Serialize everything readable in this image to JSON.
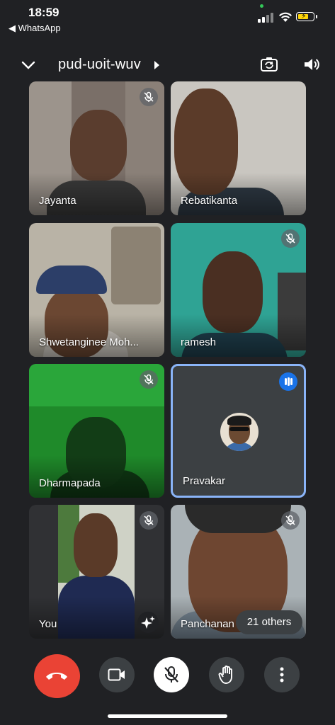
{
  "status_bar": {
    "time": "18:59",
    "back_label": "◀ WhatsApp",
    "battery_color": "#ffd60a"
  },
  "header": {
    "meeting_code": "pud-uoit-wuv",
    "icons": [
      "chevron-down-icon",
      "switch-camera-icon",
      "speaker-icon"
    ]
  },
  "tiles": [
    {
      "name": "Jayanta",
      "muted": true
    },
    {
      "name": "Rebatikanta",
      "muted": false
    },
    {
      "name": "Shwetanginee Moh...",
      "muted": false
    },
    {
      "name": "ramesh",
      "muted": true
    },
    {
      "name": "Dharmapada",
      "muted": true
    },
    {
      "name": "Pravakar",
      "muted": false,
      "speaking": true,
      "highlight_color": "#8ab4f8"
    },
    {
      "name": "You",
      "muted": true
    },
    {
      "name": "Panchanan",
      "muted": true
    }
  ],
  "others_badge": "21 others",
  "controls": {
    "items": [
      "end-call-button",
      "camera-button",
      "microphone-button",
      "raise-hand-button",
      "more-options-button"
    ],
    "end_call_color": "#ea4335"
  }
}
